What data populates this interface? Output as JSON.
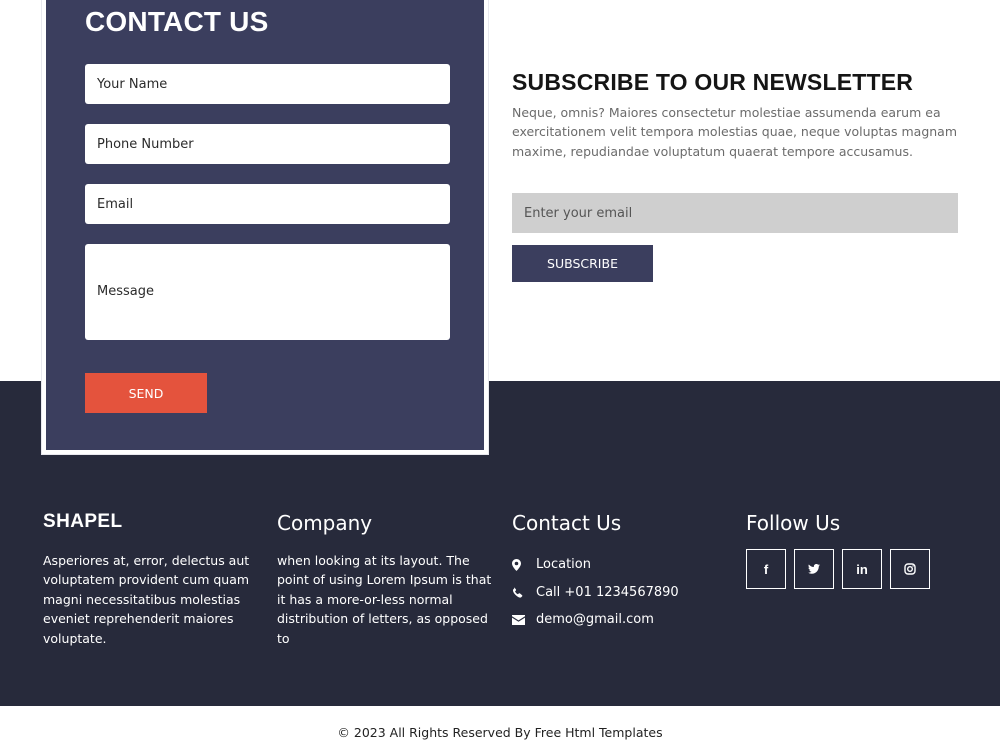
{
  "contact": {
    "title": "CONTACT US",
    "name_placeholder": "Your Name",
    "phone_placeholder": "Phone Number",
    "email_placeholder": "Email",
    "message_placeholder": "Message",
    "send_label": "SEND"
  },
  "newsletter": {
    "title": "SUBSCRIBE TO OUR NEWSLETTER",
    "text": "Neque, omnis? Maiores consectetur molestiae assumenda earum ea exercitationem velit tempora molestias quae, neque voluptas magnam maxime, repudiandae voluptatum quaerat tempore accusamus.",
    "email_placeholder": "Enter your email",
    "subscribe_label": "SUBSCRIBE"
  },
  "footer": {
    "brand": {
      "title": "SHAPEL",
      "text": "Asperiores at, error, delectus aut voluptatem provident cum quam magni necessitatibus molestias eveniet reprehenderit maiores voluptate."
    },
    "company": {
      "title": "Company",
      "text": "when looking at its layout. The point of using Lorem Ipsum is that it has a more-or-less normal distribution of letters, as opposed to"
    },
    "contact": {
      "title": "Contact Us",
      "location": "Location",
      "phone": "Call +01 1234567890",
      "email": "demo@gmail.com"
    },
    "follow": {
      "title": "Follow Us",
      "icons": [
        "facebook-icon",
        "twitter-icon",
        "linkedin-icon",
        "instagram-icon"
      ]
    },
    "copyright": "© 2023 All Rights Reserved By Free Html Templates"
  },
  "colors": {
    "card": "#3b3e5e",
    "footer": "#272a3b",
    "send": "#e4533d",
    "subscribe": "#3b3e5e",
    "newsletter_input": "#cfcfcf"
  }
}
